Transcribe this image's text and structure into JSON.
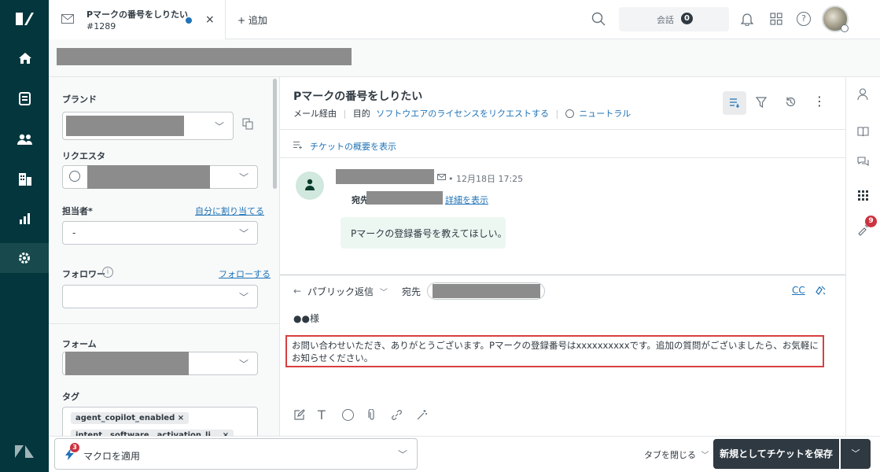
{
  "tab": {
    "title": "Pマークの番号をしりたい",
    "id": "#1289",
    "add_label": "+ 追加"
  },
  "header": {
    "conversations_label": "会話",
    "conversations_count": "0"
  },
  "sidebar_fields": {
    "brand_label": "ブランド",
    "requester_label": "リクエスタ",
    "assignee_label": "担当者*",
    "assign_self_link": "自分に割り当てる",
    "assignee_value": "-",
    "followers_label": "フォロワー",
    "follow_link": "フォローする",
    "form_label": "フォーム",
    "tags_label": "タグ",
    "tag_1": "agent_copilot_enabled ×",
    "tag_2": "intent__software__activation_li... ×"
  },
  "ticket": {
    "title": "Pマークの番号をしりたい",
    "via": "メール経由",
    "intent_label": "目的",
    "intent_value": "ソフトウエアのライセンスをリクエストする",
    "sentiment": "ニュートラル",
    "summary_link": "チケットの概要を表示"
  },
  "message": {
    "time": "• 12月18日 17:25",
    "to_label": "宛先:",
    "details_link": "詳細を表示",
    "body": "Pマークの登録番号を教えてほしい。"
  },
  "composer": {
    "reply_type": "パブリック返信",
    "to_label": "宛先",
    "cc_label": "CC",
    "salutation": "●●様",
    "reply_text": "お問い合わせいただき、ありがとうございます。Pマークの登録番号はxxxxxxxxxxです。追加の質問がございましたら、お気軽にお知らせください。"
  },
  "footer": {
    "macro_badge": "3",
    "macro_label": "マクロを適用",
    "close_tab_label": "タブを閉じる",
    "save_label": "新規としてチケットを保存"
  },
  "right_rail": {
    "badge": "9"
  },
  "colors": {
    "nav_bg": "#03363d",
    "accent_red": "#d93f3f",
    "save_bg": "#2f3941",
    "link": "#1f73b7"
  }
}
